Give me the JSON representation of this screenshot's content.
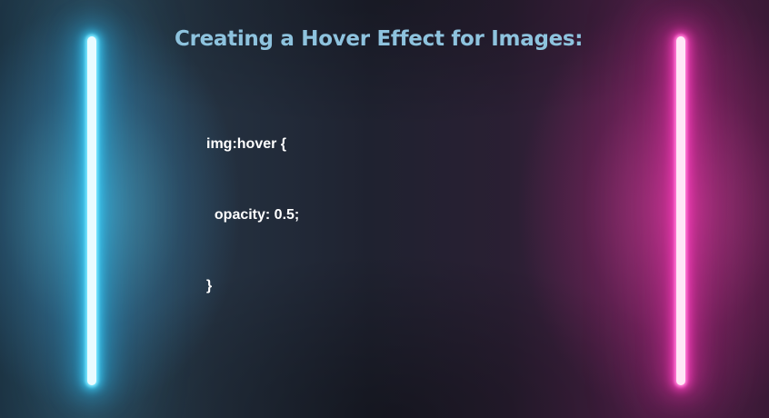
{
  "heading": "Creating a Hover Effect for Images:",
  "code_lines": [
    "img:hover {",
    "  opacity: 0.5;",
    "}"
  ],
  "colors": {
    "heading": "#8ec3de",
    "code_text": "#ffffff",
    "left_neon": "#3cc9f2",
    "right_neon": "#f03cb6"
  }
}
